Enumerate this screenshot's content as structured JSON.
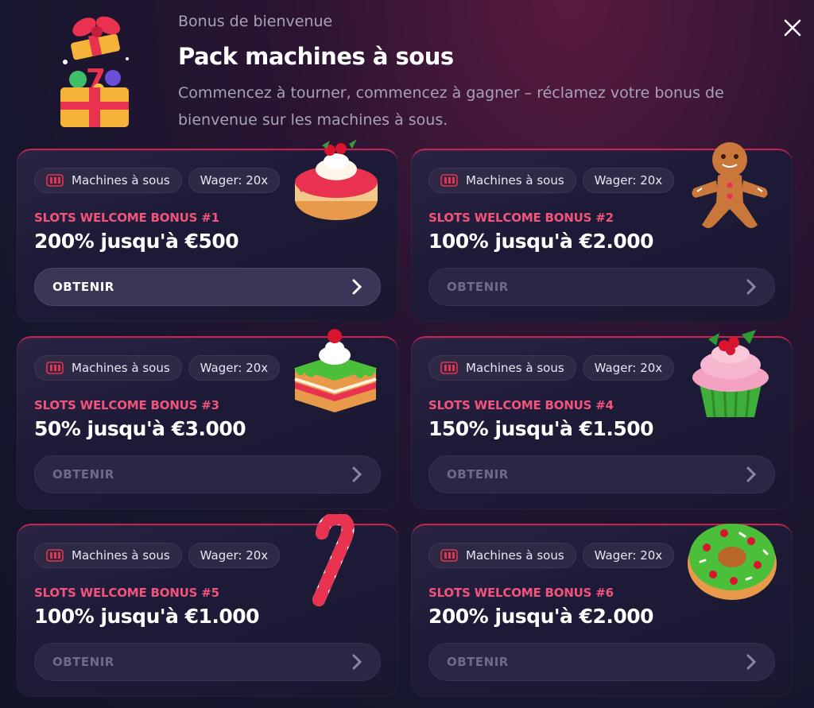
{
  "header": {
    "eyebrow": "Bonus de bienvenue",
    "title": "Pack machines à sous",
    "description": "Commencez à tourner, commencez à gagner – réclamez votre bonus de bienvenue sur les machines à sous."
  },
  "colors": {
    "accent": "#f2547c",
    "card_border": "#c8244a",
    "background": "#16162e"
  },
  "cards": [
    {
      "tag_category": "Machines à sous",
      "tag_wager": "Wager: 20x",
      "label": "SLOTS WELCOME BONUS #1",
      "amount": "200% jusqu'à €500",
      "button": "OBTENIR",
      "treat": "cake-icon"
    },
    {
      "tag_category": "Machines à sous",
      "tag_wager": "Wager: 20x",
      "label": "SLOTS WELCOME BONUS #2",
      "amount": "100% jusqu'à €2.000",
      "button": "OBTENIR",
      "treat": "gingerbread-man-icon"
    },
    {
      "tag_category": "Machines à sous",
      "tag_wager": "Wager: 20x",
      "label": "SLOTS WELCOME BONUS #3",
      "amount": "50% jusqu'à €3.000",
      "button": "OBTENIR",
      "treat": "cake-slice-icon"
    },
    {
      "tag_category": "Machines à sous",
      "tag_wager": "Wager: 20x",
      "label": "SLOTS WELCOME BONUS #4",
      "amount": "150% jusqu'à €1.500",
      "button": "OBTENIR",
      "treat": "cupcake-icon"
    },
    {
      "tag_category": "Machines à sous",
      "tag_wager": "Wager: 20x",
      "label": "SLOTS WELCOME BONUS #5",
      "amount": "100% jusqu'à €1.000",
      "button": "OBTENIR",
      "treat": "candy-cane-icon"
    },
    {
      "tag_category": "Machines à sous",
      "tag_wager": "Wager: 20x",
      "label": "SLOTS WELCOME BONUS #6",
      "amount": "200% jusqu'à €2.000",
      "button": "OBTENIR",
      "treat": "donut-icon"
    }
  ]
}
